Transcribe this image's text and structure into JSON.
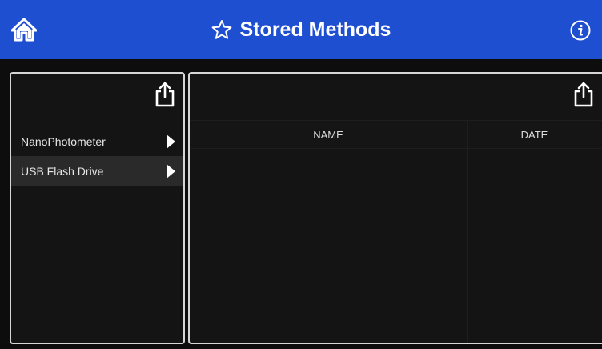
{
  "header": {
    "title": "Stored Methods",
    "home_icon": "home-icon",
    "star_icon": "star-icon",
    "info_icon": "info-icon",
    "bar_color": "#1f4fd1"
  },
  "sources": {
    "export_icon": "export-icon",
    "items": [
      {
        "label": "NanoPhotometer",
        "selected": false
      },
      {
        "label": "USB Flash Drive",
        "selected": true
      }
    ]
  },
  "methods_table": {
    "export_icon": "export-icon",
    "columns": [
      "NAME",
      "DATE"
    ],
    "rows": []
  }
}
